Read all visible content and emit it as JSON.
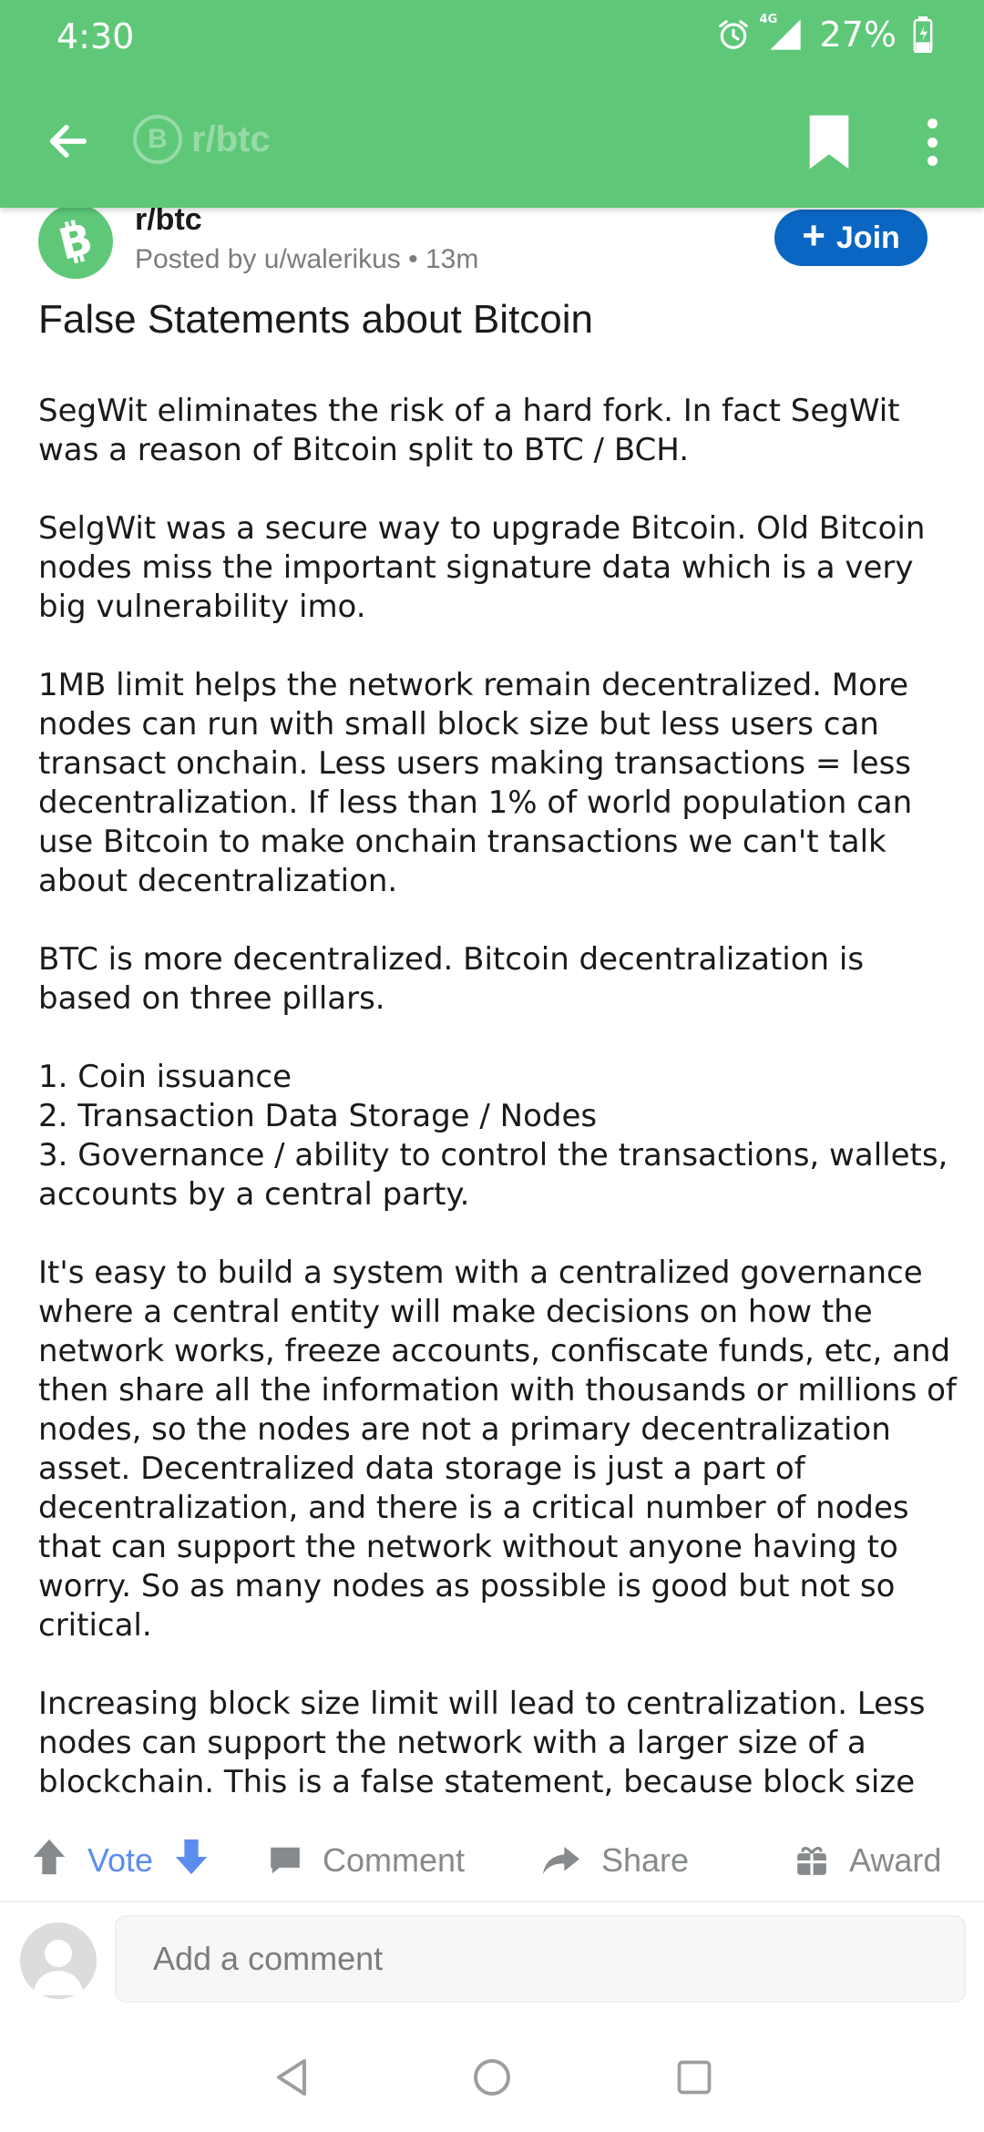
{
  "status_bar": {
    "time": "4:30",
    "network": "4G",
    "battery": "27%",
    "icons": [
      "alarm-icon",
      "signal-icon",
      "battery-charging-icon"
    ]
  },
  "app_bar": {
    "subreddit": "r/btc",
    "subreddit_icon_letter": "B",
    "icons": [
      "back-arrow-icon",
      "bookmark-icon",
      "more-vert-icon"
    ]
  },
  "post": {
    "subreddit": "r/btc",
    "meta": "Posted by u/walerikus • 13m",
    "join_label": "Join",
    "title": "False Statements about Bitcoin",
    "paragraphs": [
      "SegWit eliminates the risk of a hard fork. In fact SegWit was a reason of Bitcoin split to BTC / BCH.",
      "SelgWit was a secure way to upgrade Bitcoin. Old Bitcoin nodes miss the important signature data which is a very big vulnerability imo.",
      "1MB limit helps the network remain decentralized. More nodes can run with small block size but less users can transact onchain. Less users making transactions = less decentralization. If less than 1% of world population can use Bitcoin to make onchain transactions we can't talk about decentralization.",
      "BTC is more decentralized. Bitcoin decentralization is based on three pillars.",
      "1. Coin issuance\n2. Transaction Data Storage / Nodes\n3. Governance / ability to control the transactions, wallets, accounts by a central party.",
      "It's easy to build a system with a centralized governance where a central entity will make decisions on how the network works, freeze accounts, confiscate funds, etc, and then share all the information with thousands or millions of nodes, so the nodes are not a primary decentralization asset. Decentralized data storage is just a part of decentralization, and there is a critical number of nodes that can support the network without anyone having to worry. So as many nodes as possible is good but not so critical.",
      "Increasing block size limit will lead to centralization. Less nodes can support the network with a larger size of a blockchain. This is a false statement, because block size"
    ]
  },
  "actions": {
    "vote": "Vote",
    "comment": "Comment",
    "share": "Share",
    "award": "Award"
  },
  "comment_box": {
    "placeholder": "Add a comment"
  },
  "colors": {
    "app_bar": "#5ec878",
    "join_button": "#0a66c2",
    "vote_accent": "#5b8def",
    "muted": "#878a8c"
  }
}
